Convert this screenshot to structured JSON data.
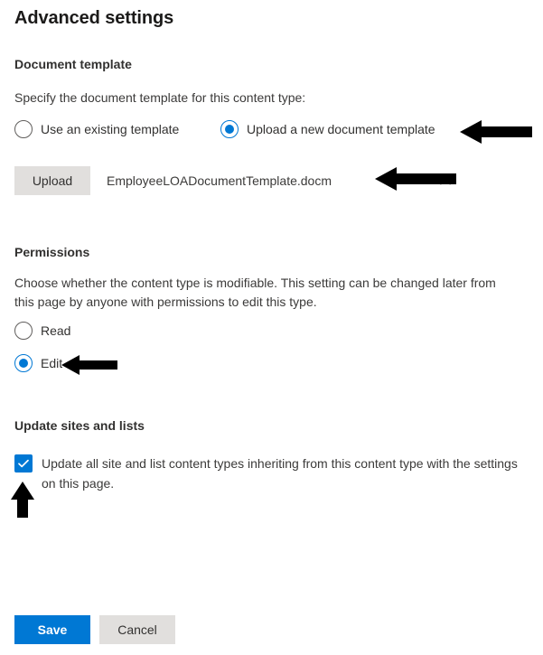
{
  "page": {
    "title": "Advanced settings"
  },
  "document_template": {
    "heading": "Document template",
    "description": "Specify the document template for this content type:",
    "options": [
      {
        "label": "Use an existing template",
        "checked": false
      },
      {
        "label": "Upload a new document template",
        "checked": true
      }
    ],
    "upload_button_label": "Upload",
    "uploaded_filename": "EmployeeLOADocumentTemplate.docm",
    "chevron_icon": "chevron-up-icon"
  },
  "permissions": {
    "heading": "Permissions",
    "description": "Choose whether the content type is modifiable. This setting can be changed later from this page by anyone with permissions to edit this type.",
    "options": [
      {
        "label": "Read",
        "checked": false
      },
      {
        "label": "Edit",
        "checked": true
      }
    ]
  },
  "update_sites_and_lists": {
    "heading": "Update sites and lists",
    "checkbox_label": "Update all site and list content types inheriting from this content type with the settings on this page.",
    "checked": true
  },
  "footer": {
    "save_label": "Save",
    "cancel_label": "Cancel"
  },
  "annotations": [
    {
      "name": "arrow-upload-radio",
      "direction": "left"
    },
    {
      "name": "arrow-filename",
      "direction": "left"
    },
    {
      "name": "arrow-edit-radio",
      "direction": "left"
    },
    {
      "name": "arrow-checkbox",
      "direction": "up"
    }
  ],
  "colors": {
    "accent": "#0078d4",
    "neutral_button": "#e1dfdd",
    "text": "#323130",
    "body_text": "#3b3a39",
    "radio_border": "#605e5c"
  }
}
